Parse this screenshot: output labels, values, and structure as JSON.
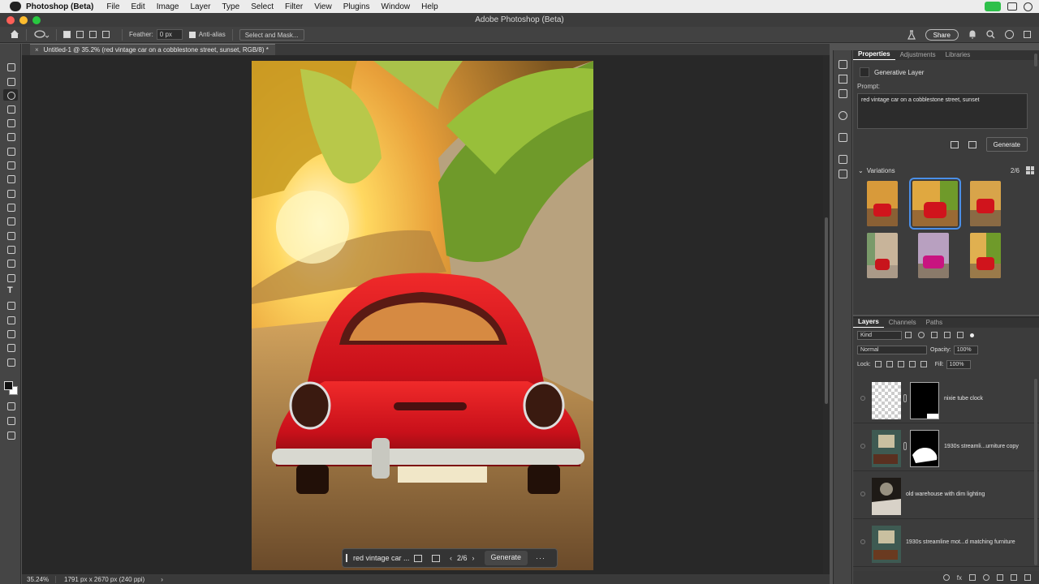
{
  "menubar": {
    "app_name": "Photoshop (Beta)",
    "items": [
      "File",
      "Edit",
      "Image",
      "Layer",
      "Type",
      "Select",
      "Filter",
      "View",
      "Plugins",
      "Window",
      "Help"
    ]
  },
  "window": {
    "title": "Adobe Photoshop (Beta)"
  },
  "options": {
    "feather_label": "Feather:",
    "feather_value": "0 px",
    "antialias_label": "Anti-alias",
    "select_mask_label": "Select and Mask...",
    "share_label": "Share"
  },
  "document": {
    "tab_title": "Untitled-1 @ 35.2% (red vintage car on a cobblestone street, sunset, RGB/8) *",
    "close_glyph": "×"
  },
  "contextual_bar": {
    "prompt": "red vintage car ...",
    "prev_glyph": "‹",
    "next_glyph": "›",
    "counter": "2/6",
    "generate_label": "Generate",
    "more_glyph": "···"
  },
  "status": {
    "zoom": "35.24%",
    "info": "1791 px x 2670 px (240 ppi)",
    "arrow": "›"
  },
  "properties": {
    "tabs": [
      "Properties",
      "Adjustments",
      "Libraries"
    ],
    "layer_type": "Generative Layer",
    "prompt_label": "Prompt:",
    "prompt_text": "red vintage car on a cobblestone street, sunset",
    "generate_label": "Generate",
    "variations_label": "Variations",
    "variations_count": "2/6"
  },
  "layers": {
    "tabs": [
      "Layers",
      "Channels",
      "Paths"
    ],
    "kind_label": "Kind",
    "blend_mode": "Normal",
    "opacity_label": "Opacity:",
    "opacity_value": "100%",
    "lock_label": "Lock:",
    "fill_label": "Fill:",
    "fill_value": "100%",
    "items": [
      {
        "name": "nixie tube clock"
      },
      {
        "name": "1930s streamli...urniture copy"
      },
      {
        "name": "old warehouse with dim lighting"
      },
      {
        "name": "1930s streamline mot...d matching furniture"
      }
    ],
    "footer_fx": "fx"
  },
  "colors": {
    "accent_blue": "#4a8fe8",
    "car_red": "#d9141c",
    "traffic_red": "#fe5f57",
    "traffic_yellow": "#febc2e",
    "traffic_green": "#28c840"
  }
}
